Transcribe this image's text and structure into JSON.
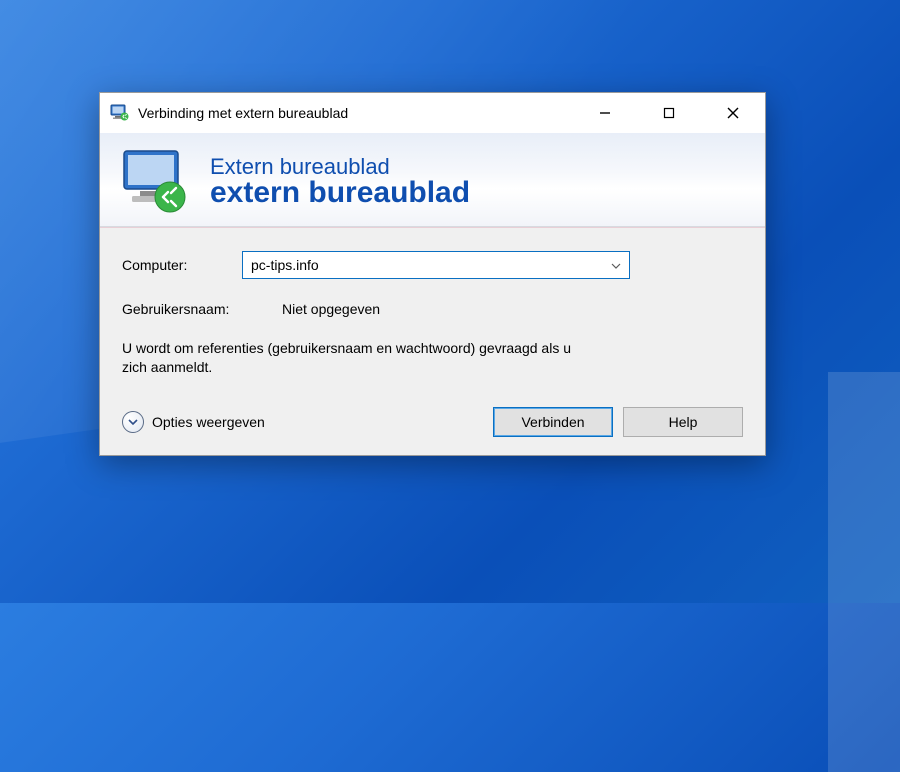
{
  "titlebar": {
    "title": "Verbinding met extern bureaublad"
  },
  "banner": {
    "line1": "Extern bureaublad",
    "line2": "extern bureaublad"
  },
  "form": {
    "computer_label": "Computer:",
    "computer_value": "pc-tips.info",
    "username_label": "Gebruikersnaam:",
    "username_value": "Niet opgegeven",
    "info_text": "U wordt om referenties (gebruikersnaam en wachtwoord) gevraagd als u zich aanmeldt."
  },
  "footer": {
    "options_label": "Opties weergeven",
    "connect_label": "Verbinden",
    "help_label": "Help"
  }
}
